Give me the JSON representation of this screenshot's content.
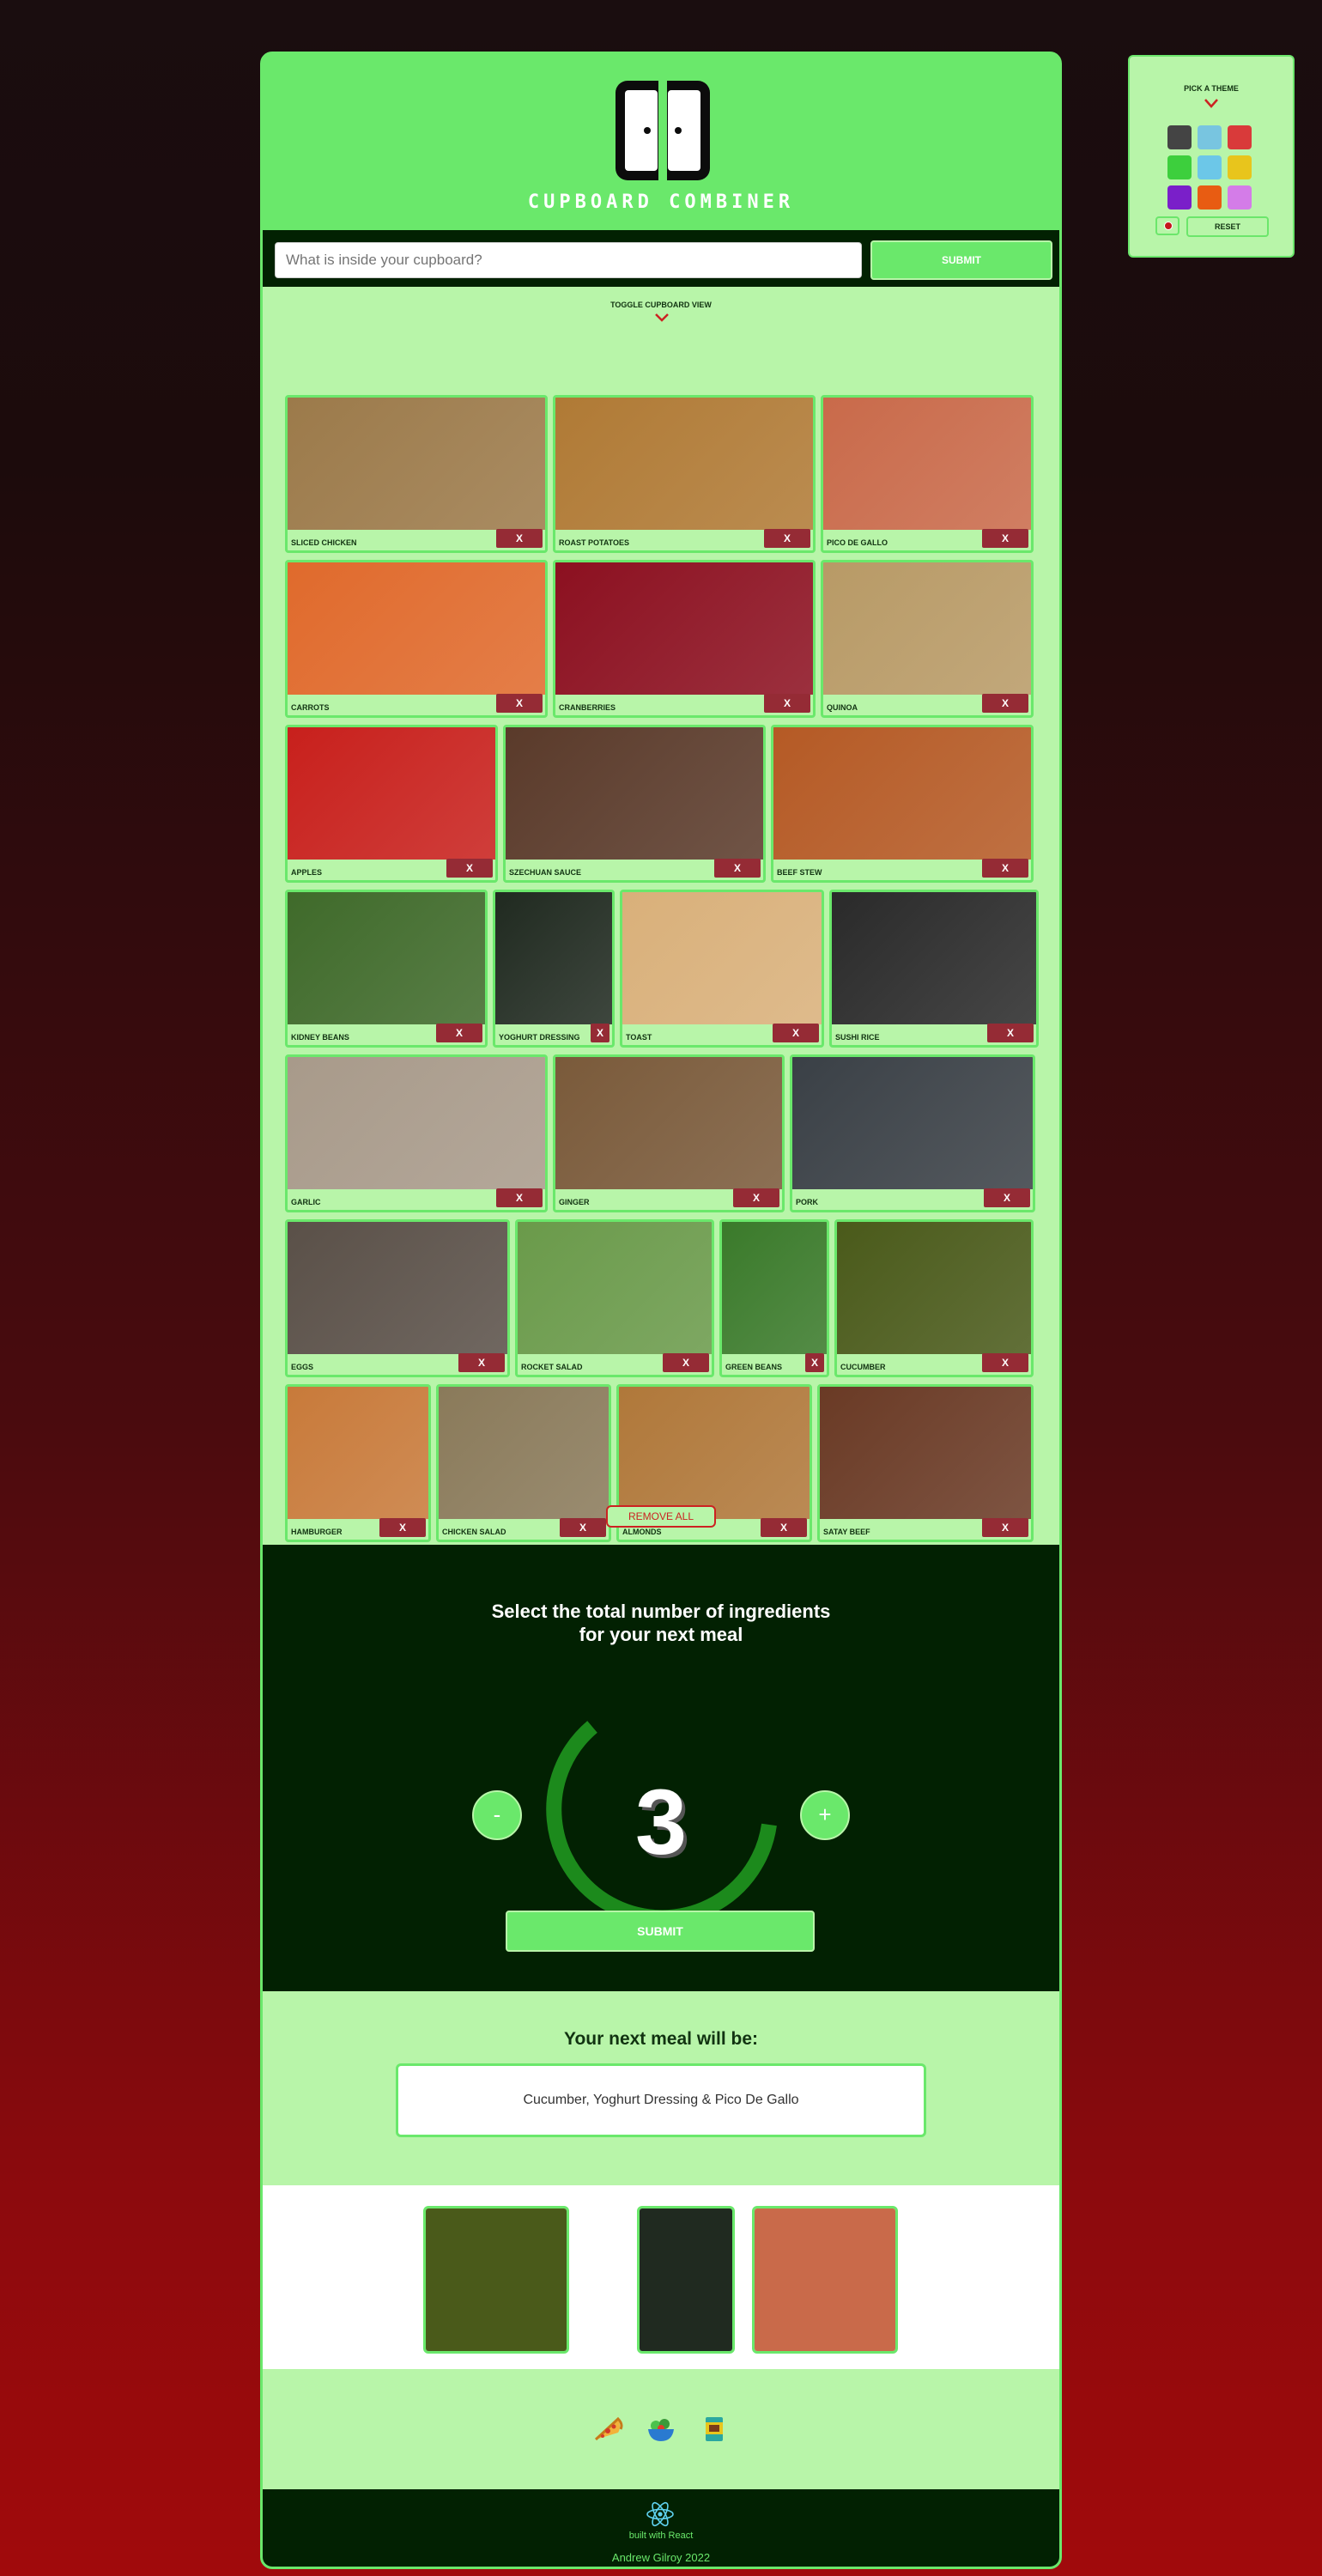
{
  "theme_picker": {
    "title": "PICK A THEME",
    "swatches": [
      "#444444",
      "#78c5e0",
      "#d93a3a",
      "#3dcf3d",
      "#6cc7e8",
      "#e8c51c",
      "#7a1fc9",
      "#e85c12",
      "#d47ce8"
    ],
    "reset_label": "RESET"
  },
  "header": {
    "logo_text": "CUPBOARD COMBINER"
  },
  "search": {
    "placeholder": "What is inside your cupboard?",
    "submit_label": "SUBMIT"
  },
  "cupboard": {
    "toggle_label": "TOGGLE CUPBOARD VIEW",
    "remove_label": "X",
    "items": [
      {
        "label": "SLICED CHICKEN",
        "color": "#9c7a4a"
      },
      {
        "label": "ROAST POTATOES",
        "color": "#b07a35"
      },
      {
        "label": "PICO DE GALLO",
        "color": "#c96a4a"
      },
      {
        "label": "CARROTS",
        "color": "#e06a2c"
      },
      {
        "label": "CRANBERRIES",
        "color": "#8c1020"
      },
      {
        "label": "QUINOA",
        "color": "#b89a66"
      },
      {
        "label": "APPLES",
        "color": "#c8201c"
      },
      {
        "label": "SZECHUAN SAUCE",
        "color": "#5a3a2a"
      },
      {
        "label": "BEEF STEW",
        "color": "#b55a25"
      },
      {
        "label": "KIDNEY BEANS",
        "color": "#3f6a2a"
      },
      {
        "label": "YOGHURT DRESSING",
        "color": "#202a20"
      },
      {
        "label": "TOAST",
        "color": "#d9b07a"
      },
      {
        "label": "SUSHI RICE",
        "color": "#2a2a2a"
      },
      {
        "label": "GARLIC",
        "color": "#a89a8a"
      },
      {
        "label": "GINGER",
        "color": "#7a5a3a"
      },
      {
        "label": "PORK",
        "color": "#3a4046"
      },
      {
        "label": "EGGS",
        "color": "#5a5048"
      },
      {
        "label": "ROCKET SALAD",
        "color": "#6a9a4a"
      },
      {
        "label": "GREEN BEANS",
        "color": "#3a7a2a"
      },
      {
        "label": "CUCUMBER",
        "color": "#4a5a1a"
      },
      {
        "label": "HAMBURGER",
        "color": "#c87a3a"
      },
      {
        "label": "CHICKEN SALAD",
        "color": "#8a7a5a"
      },
      {
        "label": "ALMONDS",
        "color": "#b0783a"
      },
      {
        "label": "SATAY BEEF",
        "color": "#6a3a25"
      }
    ],
    "remove_all_label": "REMOVE ALL"
  },
  "selector": {
    "title_line1": "Select the total number of ingredients",
    "title_line2": "for your next meal",
    "count": "3",
    "minus_label": "-",
    "plus_label": "+",
    "submit_label": "SUBMIT"
  },
  "result": {
    "title": "Your next meal will be:",
    "meal": "Cucumber, Yoghurt Dressing & Pico De Gallo"
  },
  "meal_images": [
    {
      "name": "cucumber",
      "color": "#4a5a1a"
    },
    {
      "name": "yoghurt dressing",
      "color": "#202a20"
    },
    {
      "name": "pico de gallo",
      "color": "#c96a4a"
    }
  ],
  "footer": {
    "built_with": "built with React",
    "author": "Andrew Gilroy 2022"
  }
}
